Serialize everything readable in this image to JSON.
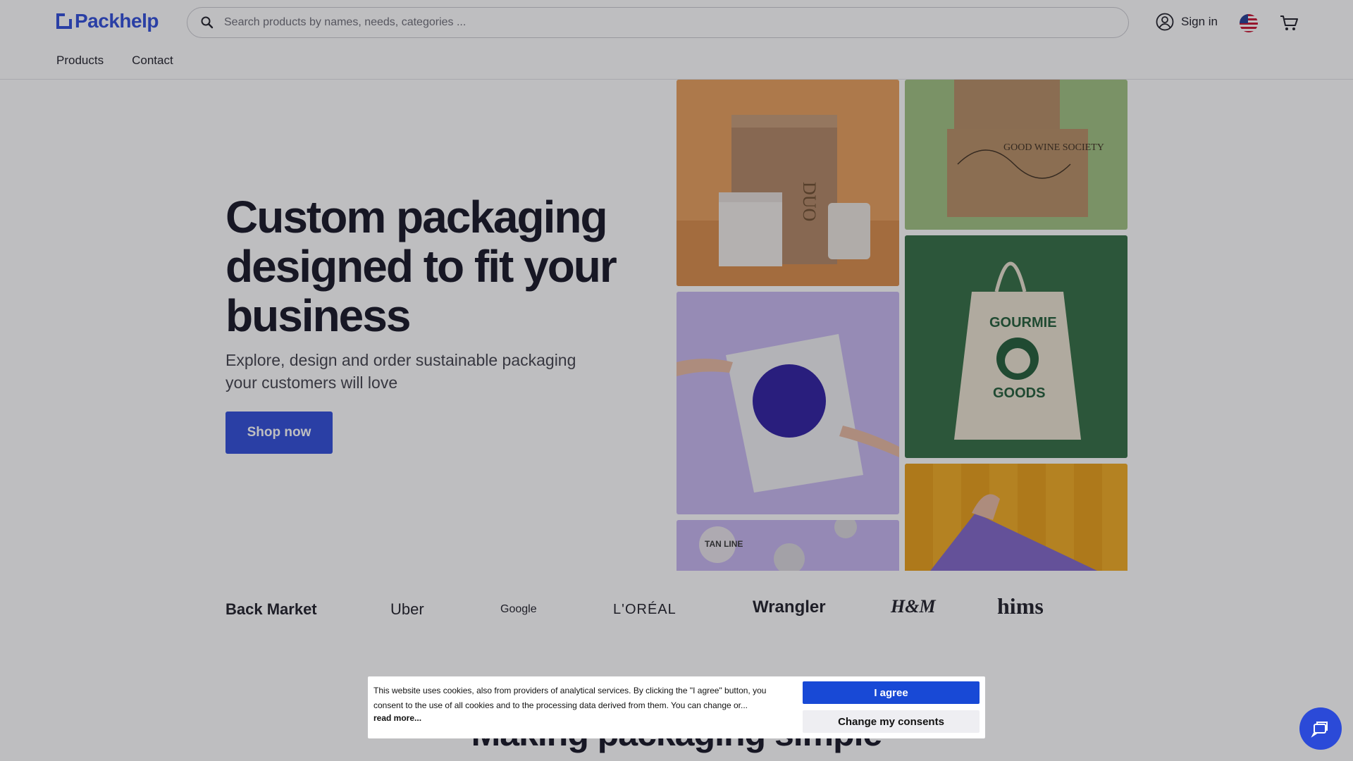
{
  "header": {
    "logo_text": "Packhelp",
    "search_placeholder": "Search products by names, needs, categories ...",
    "signin_label": "Sign in",
    "nav": [
      "Products",
      "Contact"
    ]
  },
  "hero": {
    "title": "Custom packaging designed to fit your business",
    "subtitle": "Explore, design and order sustainable packaging your customers will love",
    "cta_label": "Shop now",
    "tiles": {
      "duo_box": "DUO",
      "wine_box": "GOOD WINE SOCIETY",
      "tote_text_top": "GOURMIE",
      "tote_text_bottom": "GOODS",
      "sticker": "TAN LINE"
    }
  },
  "brands": [
    "Back Market",
    "Uber",
    "Google",
    "L'ORÉAL",
    "Wrangler",
    "H&M",
    "hims"
  ],
  "section_title": "Making packaging simple",
  "cookie": {
    "text": "This website uses cookies, also from providers of analytical services. By clicking the \"I agree\" button, you consent to the use of all cookies and to the processing data derived from them. You can change or...",
    "read_more": "read more...",
    "agree_label": "I agree",
    "change_label": "Change my consents"
  },
  "colors": {
    "brand": "#2b4ad8",
    "agree": "#1849d6"
  },
  "icons": [
    "search-icon",
    "user-icon",
    "us-flag-icon",
    "cart-icon",
    "chat-icon"
  ]
}
